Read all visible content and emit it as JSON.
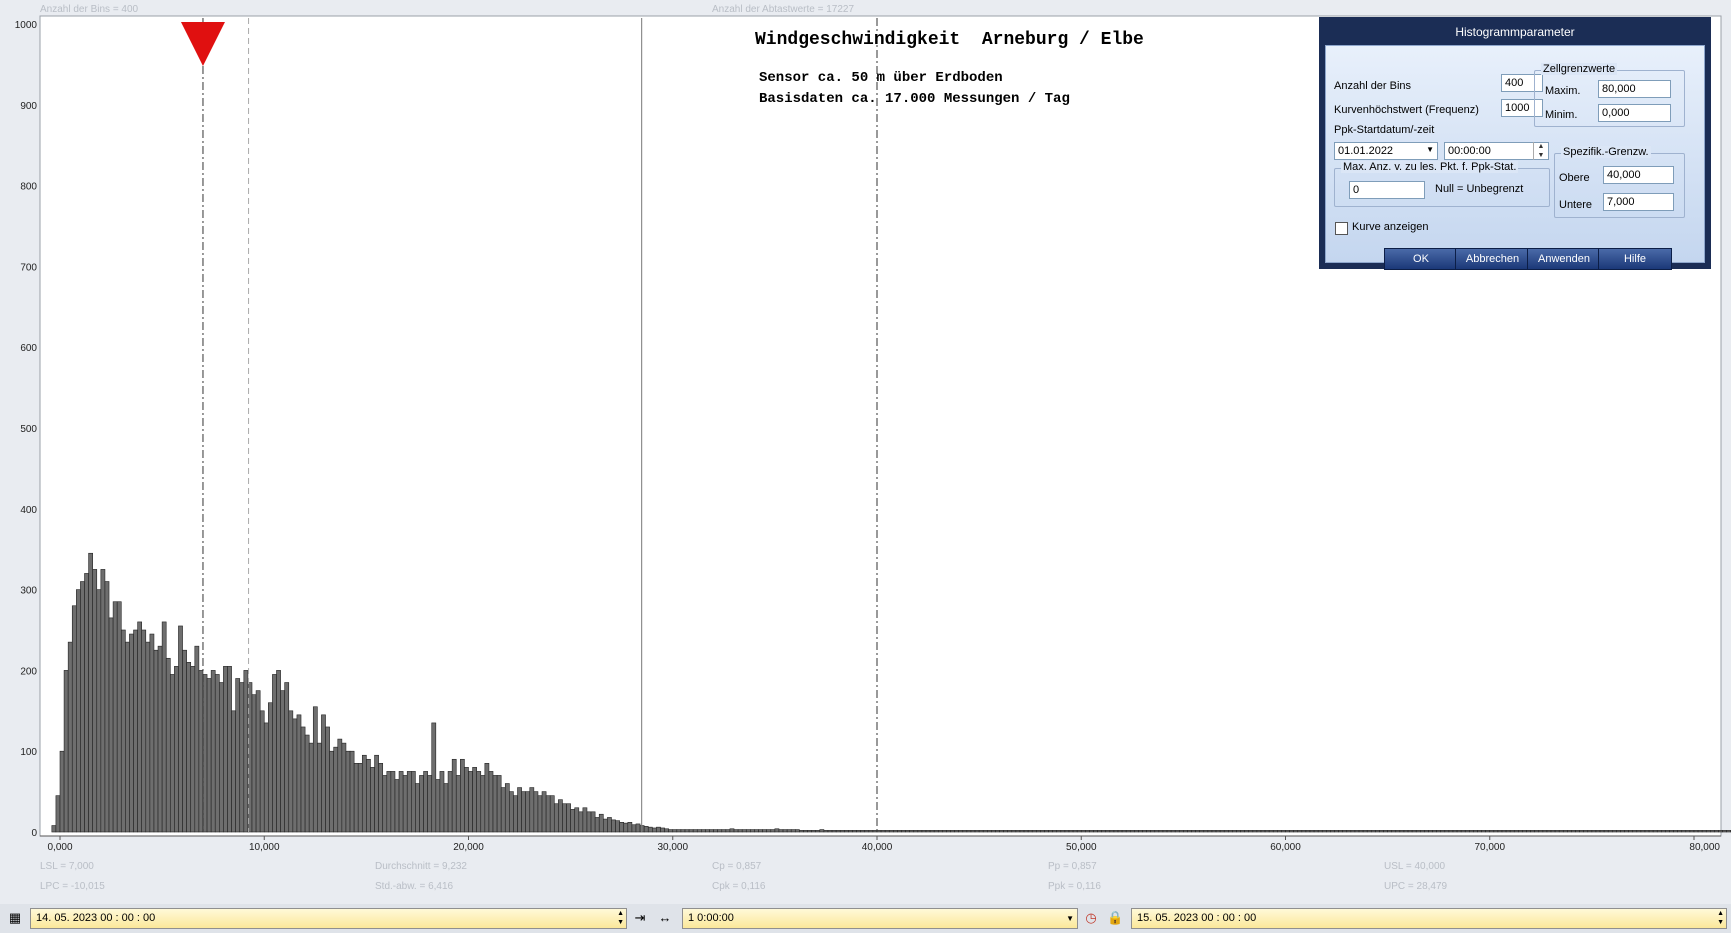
{
  "top_info": {
    "bins_label": "Anzahl der Bins =  400",
    "samples_label": "Anzahl der Abtastwerte = 17227"
  },
  "chart_data": {
    "type": "bar",
    "title": "Windgeschwindigkeit  Arneburg / Elbe",
    "subtitle_lines": [
      "Sensor ca. 50 m über Erdboden",
      "Basisdaten ca. 17.000 Messungen / Tag"
    ],
    "xlabel": "",
    "ylabel": "",
    "xlim": [
      -1,
      80
    ],
    "ylim": [
      0,
      1000
    ],
    "x_ticks": [
      0,
      10,
      20,
      30,
      40,
      50,
      60,
      70,
      80
    ],
    "x_tick_labels": [
      "0,000",
      "10,000",
      "20,000",
      "30,000",
      "40,000",
      "50,000",
      "60,000",
      "70,000",
      "80,000"
    ],
    "y_ticks": [
      0,
      100,
      200,
      300,
      400,
      500,
      600,
      700,
      800,
      900,
      1000
    ],
    "y_tick_labels": [
      "0",
      "100",
      "200",
      "300",
      "400",
      "500",
      "600",
      "700",
      "800",
      "900",
      "1000"
    ],
    "bin_width": 0.2,
    "bin_start": -0.4,
    "values": [
      8,
      45,
      100,
      200,
      235,
      280,
      300,
      310,
      320,
      345,
      325,
      300,
      325,
      310,
      265,
      285,
      285,
      250,
      235,
      245,
      250,
      260,
      250,
      235,
      245,
      225,
      230,
      260,
      215,
      195,
      205,
      255,
      225,
      210,
      205,
      230,
      200,
      195,
      190,
      200,
      195,
      185,
      205,
      205,
      150,
      190,
      185,
      200,
      185,
      170,
      175,
      150,
      135,
      160,
      195,
      200,
      175,
      185,
      150,
      140,
      145,
      130,
      120,
      110,
      155,
      110,
      145,
      130,
      100,
      105,
      115,
      110,
      100,
      100,
      85,
      85,
      95,
      90,
      80,
      95,
      85,
      70,
      75,
      75,
      65,
      75,
      70,
      75,
      75,
      60,
      70,
      75,
      70,
      135,
      65,
      75,
      60,
      75,
      90,
      70,
      90,
      80,
      75,
      80,
      75,
      70,
      85,
      75,
      70,
      70,
      55,
      60,
      50,
      45,
      55,
      50,
      50,
      55,
      50,
      45,
      50,
      45,
      45,
      35,
      40,
      35,
      35,
      28,
      30,
      25,
      30,
      25,
      25,
      18,
      22,
      16,
      18,
      15,
      14,
      12,
      11,
      12,
      9,
      10,
      8,
      7,
      6,
      5,
      6,
      5,
      4,
      3,
      3,
      3,
      3,
      3,
      3,
      3,
      3,
      3,
      3,
      3,
      3,
      3,
      3,
      3,
      4,
      3,
      3,
      3,
      3,
      3,
      3,
      3,
      3,
      3,
      3,
      4,
      3,
      3,
      3,
      3,
      3,
      2,
      2,
      2,
      2,
      2,
      3,
      2,
      2,
      2,
      2,
      2,
      2,
      2,
      2,
      2,
      2,
      2,
      2,
      2,
      2,
      2,
      2,
      2,
      2,
      2,
      2,
      2,
      2,
      2,
      2,
      2,
      2,
      2,
      2,
      2,
      2,
      2,
      2,
      2,
      2,
      2,
      2,
      2,
      2,
      2,
      2,
      2,
      2,
      2,
      2,
      2,
      2,
      2,
      2,
      2,
      2,
      2,
      2,
      2,
      2,
      2,
      2,
      2,
      2,
      2,
      2,
      2,
      2,
      2,
      2,
      2,
      2,
      2,
      2,
      2,
      2,
      2,
      2,
      2,
      2,
      2,
      2,
      2,
      2,
      2,
      2,
      2,
      2,
      2,
      2,
      2,
      2,
      2,
      2,
      2,
      2,
      2,
      2,
      2,
      2,
      2,
      2,
      2,
      2,
      2,
      2,
      2,
      2,
      2,
      2,
      2,
      2,
      2,
      2,
      2,
      2,
      2,
      2,
      2,
      2,
      2,
      2,
      2,
      2,
      2,
      2,
      2,
      2,
      2,
      2,
      2,
      2,
      2,
      2,
      2,
      2,
      2,
      2,
      2,
      2,
      2,
      2,
      2,
      2,
      2,
      2,
      2,
      2,
      2,
      2,
      2,
      2,
      2,
      2,
      2,
      2,
      2,
      2,
      2,
      2,
      2,
      2,
      2,
      2,
      2,
      2,
      2,
      2,
      2,
      2,
      2,
      2,
      2,
      2,
      2,
      2,
      2,
      2,
      2,
      2,
      2,
      2,
      2,
      2,
      2,
      2,
      2,
      2,
      2,
      2,
      2,
      2,
      2,
      2,
      2,
      2,
      2,
      2,
      2,
      2,
      2,
      2,
      2,
      2,
      2,
      2,
      2,
      2,
      2,
      2,
      2,
      2,
      2,
      2,
      2,
      2,
      2,
      2,
      2,
      2,
      2,
      2,
      2,
      2,
      2,
      2,
      2,
      2,
      2,
      2
    ],
    "lsl": 7,
    "usl": 40,
    "mean": 9.232,
    "upc": 28.479,
    "marker_at": 7,
    "grid": false,
    "bar_color": "#6e6e6e",
    "marker_color": "#e01010"
  },
  "stats": {
    "lsl": "LSL = 7,000",
    "lpc": "LPC = -10,015",
    "mean": "Durchschnitt  = 9,232",
    "std": "Std.-abw. = 6,416",
    "cp": "Cp  = 0,857",
    "cpk": "Cpk = 0,116",
    "pp": "Pp  = 0,857",
    "ppk": "Ppk = 0,116",
    "usl": "USL = 40,000",
    "upc": "UPC = 28,479"
  },
  "dialog": {
    "caption": "Histogrammparameter",
    "bins_label": "Anzahl der Bins",
    "bins_value": "400",
    "maxfreq_label": "Kurvenhöchstwert (Frequenz)",
    "maxfreq_value": "1000",
    "start_label": "Ppk-Startdatum/-zeit",
    "start_date": "01.01.2022",
    "start_time": "00:00:00",
    "cell_group": "Zellgrenzwerte",
    "max_label": "Maxim.",
    "max_value": "80,000",
    "min_label": "Minim.",
    "min_value": "0,000",
    "maxpts_group": "Max. Anz. v. zu les. Pkt. f. Ppk-Stat.",
    "maxpts_value": "0",
    "null_hint": "Null = Unbegrenzt",
    "spec_group": "Spezifik.-Grenzw.",
    "upper_label": "Obere",
    "upper_value": "40,000",
    "lower_label": "Untere",
    "lower_value": "7,000",
    "show_curve_label": "Kurve anzeigen",
    "ok": "OK",
    "cancel": "Abbrechen",
    "apply": "Anwenden",
    "help": "Hilfe"
  },
  "bottom": {
    "start": "14. 05. 2023   00 : 00 : 00",
    "interval": "1 0:00:00",
    "end": "15. 05. 2023   00 : 00 : 00"
  }
}
